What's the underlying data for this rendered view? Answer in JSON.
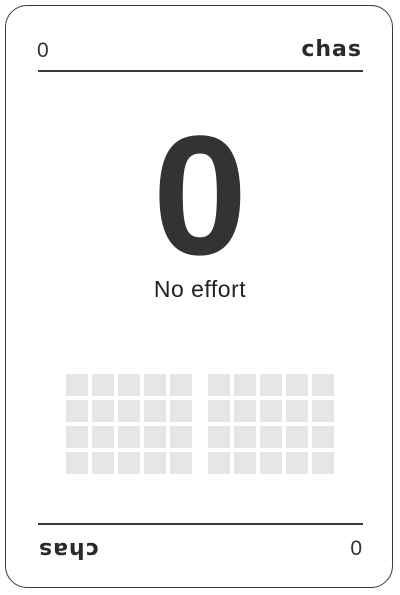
{
  "card": {
    "top_value": "0",
    "bottom_value": "0",
    "brand": "chas",
    "number": "0",
    "label": "No effort",
    "effort_filled": 0,
    "effort_total": 40,
    "cell_color": "#e6e6e6",
    "ink_color": "#333333"
  }
}
